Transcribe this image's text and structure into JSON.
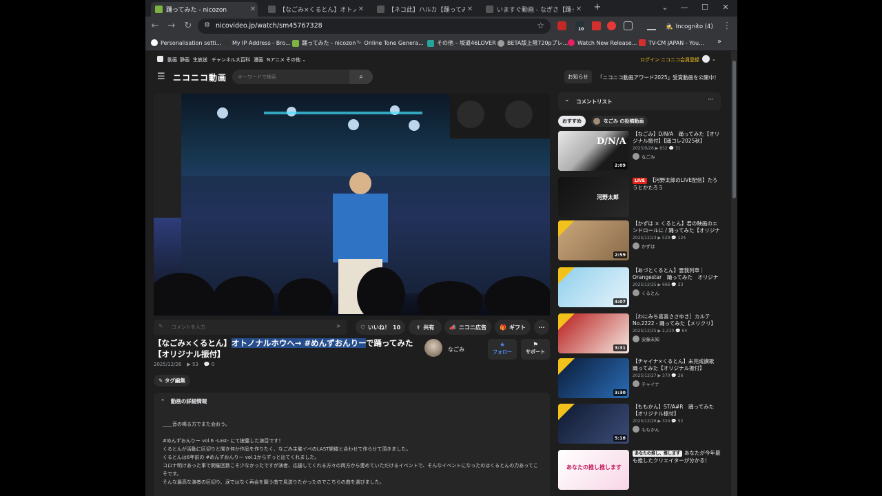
{
  "browser": {
    "tabs": [
      {
        "title": "踊ってみた - nicozon",
        "active": true
      },
      {
        "title": "【なごみ×くるとん】オトノナルホウ",
        "active": false
      },
      {
        "title": "【ネコ此】ハルカ【踊ってみた】 - ニコニ",
        "active": false
      },
      {
        "title": "いますぐ動画 - なぎさ【踊ってみた】",
        "active": false
      }
    ],
    "new_tab": "+",
    "url": "nicovideo.jp/watch/sm45767328",
    "incognito_label": "Incognito (4)",
    "ext_badge": "10",
    "bookmarks": [
      "Personalisation setti...",
      "My IP Address - Bro...",
      "踊ってみた - nicozon",
      "Online Tone Genera...",
      "その他 – 坂道46LOVER",
      "BETA版上限720pプレ...",
      "Watch New Release...",
      "TV-CM JAPAN - You..."
    ],
    "bm_more": "»"
  },
  "site": {
    "topnav": [
      "動画",
      "静画",
      "生放送",
      "チャンネル",
      "大百科",
      "漫画",
      "Nアニメ",
      "その他 ⌄"
    ],
    "login": "ログイン",
    "premium": "ニコニコ会員登録",
    "logo": "ニコニコ動画",
    "search_placeholder": "キーワードで検索",
    "notice": "お知らせ",
    "award_banner": "「ニコニコ動画アワード2025」受賞動画を公開中！"
  },
  "player": {
    "comment_placeholder": "コメントを入力",
    "like_label": "いいね！",
    "like_count": "10",
    "share_label": "共有",
    "ad_label": "ニコニ広告",
    "gift_label": "ギフト",
    "more": "···"
  },
  "video": {
    "title_pre": "【なごみ×くるとん】",
    "title_hl": "オトノナルホウへ→ #めんずおんりー",
    "title_post": "で踊ってみた【オリジナル振付】",
    "date": "2025/12/26",
    "views": "53",
    "comments": "0",
    "owner": "なごみ",
    "follow": "フォロー",
    "support": "サポート",
    "tag_edit": "タグ編集",
    "details_header": "動画の詳細情報",
    "description": [
      "____音の鳴る方でまた会おう。",
      "",
      "#めんずおんりー vol.6 -Last- にて披露した演目です！",
      "くるとんが活動に区切りと聞き何か作品を作りたく、なごみ主催イベのLAST開催と合わせて作らせて頂きました。",
      "くるとんは6年前の #めんずおんりー vol.1からずっと出てくれました。",
      "コロナ明けあった事で開催回数こそ少なかったですが演者、応援してくれる方々の両方から愛めていただけるイベントで、そんなイベントになったのはくるとんの力あってこそです。",
      "そんな最高な演者の区切り、涙ではなく再会を願う曲で見送りたかったのでこちらの曲を選びました。"
    ]
  },
  "side": {
    "header": "コメントリスト",
    "chip_rec": "おすすめ",
    "chip_owner": "なごみ の投稿動画",
    "items": [
      {
        "title": "【なごみ】D/N/A　踊ってみた【オリジナル振付】【踊コレ2025秋】",
        "date": "2025/9/26",
        "views": "832",
        "comments": "31",
        "author": "なごみ",
        "duration": "2:09"
      },
      {
        "live": "LIVE",
        "title": "【河野太郎のLIVE配信】たろうとかたろう",
        "date": "",
        "views": "",
        "comments": "",
        "author": "",
        "duration": ""
      },
      {
        "title": "【かずは × くるとん】君の映画のエンドロールに / 踊ってみた【オリジナル振付】",
        "date": "2025/12/23",
        "views": "529",
        "comments": "124",
        "author": "かずは",
        "duration": "2:59"
      },
      {
        "title": "【あづとくるとん】雲我列車｜Orangestar　踊ってみた　オリジナル",
        "date": "2025/12/25",
        "views": "666",
        "comments": "23",
        "author": "くるとん",
        "duration": "4:07"
      },
      {
        "title": "［わにみち喜喜ささゆき］カルテNo.2222 - 踊ってみた【メリクリ】",
        "date": "2025/12/25",
        "views": "2,210",
        "comments": "64",
        "author": "安藤未知",
        "duration": "3:31"
      },
      {
        "title": "【チャイナ×くるとん】未完成讃歌　踊ってみた【オリジナル振付】",
        "date": "2025/12/27",
        "views": "370",
        "comments": "26",
        "author": "チャイナ",
        "duration": "3:30"
      },
      {
        "title": "【ももかん】ST/A#R　踊ってみた【オリジナル振付】",
        "date": "2025/12/26",
        "views": "324",
        "comments": "52",
        "author": "ももかん",
        "duration": "5:18"
      },
      {
        "ad": "あなたの推し、推します",
        "title": "あなたが今年最も推したクリエイターが分かる！",
        "date": "",
        "views": "",
        "comments": "",
        "author": "",
        "duration": ""
      }
    ],
    "thumb_texts": [
      "D/N/A",
      "河野太郎",
      "あなたの推し推します"
    ]
  },
  "colors": {
    "accent_blue": "#4e8ef7",
    "highlight": "#264d8c",
    "live_red": "#e5241b",
    "badge_yellow": "#f2c21b"
  }
}
